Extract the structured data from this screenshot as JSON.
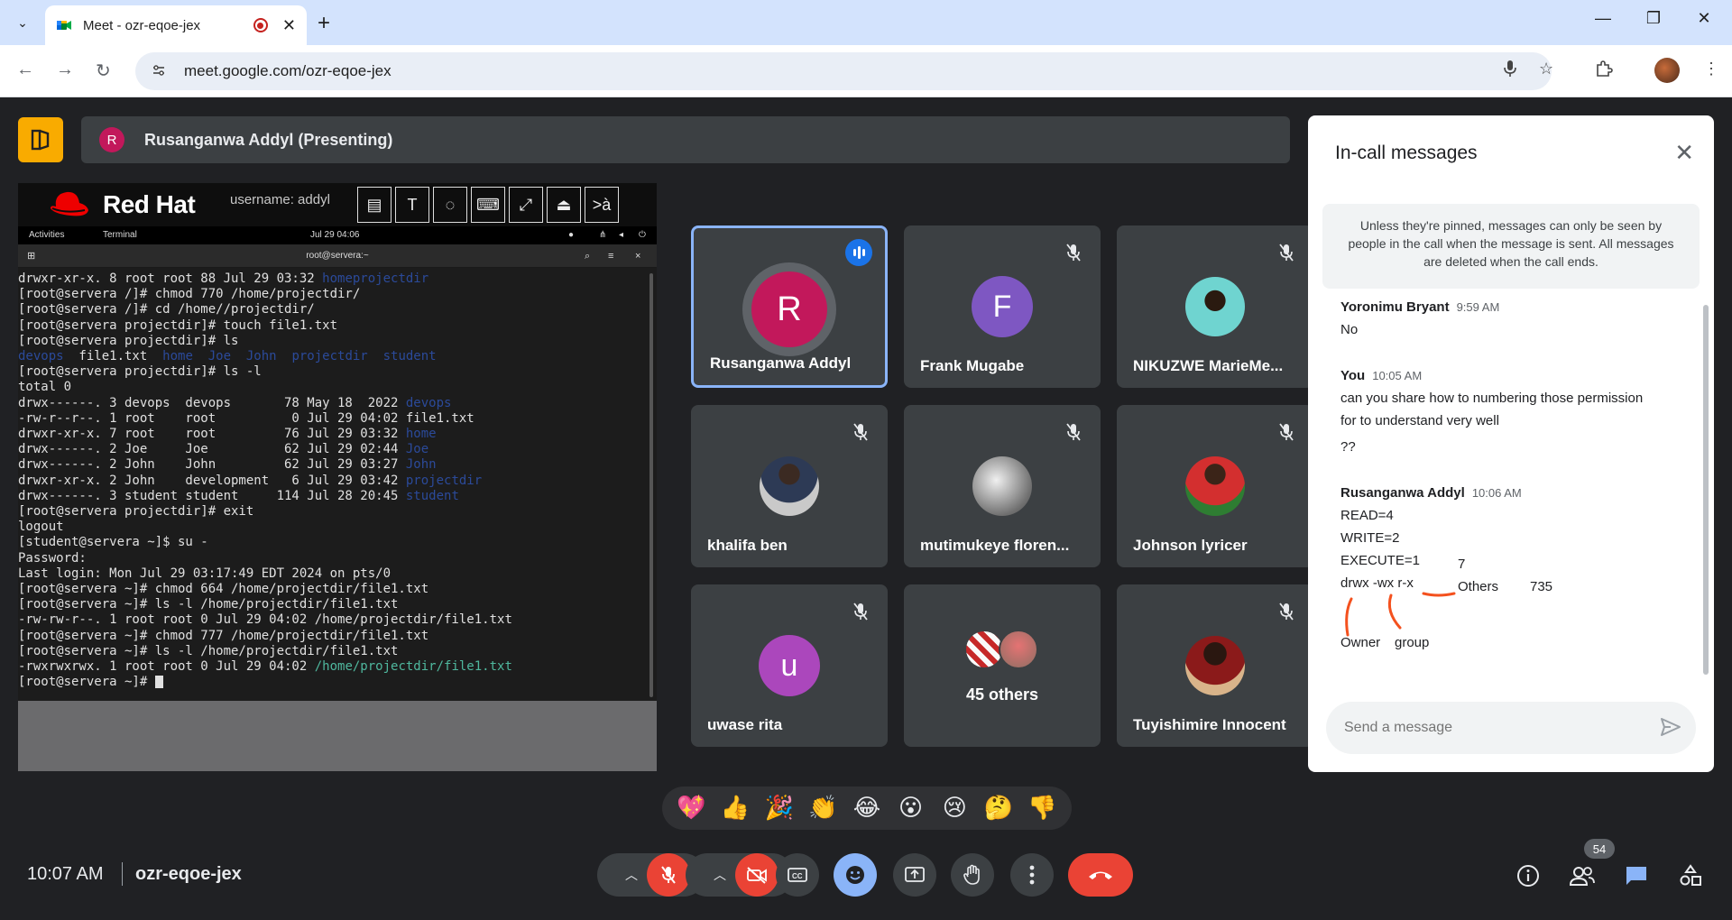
{
  "browser": {
    "tab_title": "Meet - ozr-eqoe-jex",
    "url": "meet.google.com/ozr-eqoe-jex"
  },
  "presenting": {
    "initial": "R",
    "label": "Rusanganwa Addyl (Presenting)"
  },
  "presentation": {
    "brand": "Red Hat",
    "username_label": "username: addyl",
    "tool_labels": [
      "T",
      ">à"
    ],
    "gnome": {
      "activities": "Activities",
      "terminal": "Terminal",
      "datetime": "Jul 29  04:06"
    },
    "terminal_title": "root@servera:~",
    "lines": [
      {
        "t": "drwxr-xr-x. 8 root root 88 Jul 29 03:32 ",
        "d": "homeprojectdir"
      },
      {
        "t": "[root@servera /]# chmod 770 /home/projectdir/",
        "d": ""
      },
      {
        "t": "[root@servera /]# cd /home//projectdir/",
        "d": ""
      },
      {
        "t": "[root@servera projectdir]# touch file1.txt",
        "d": ""
      },
      {
        "t": "[root@servera projectdir]# ls",
        "d": ""
      },
      {
        "t": "",
        "d": "devops",
        "t2": "  file1.txt  ",
        "d2": "home  Joe  John  projectdir  student"
      },
      {
        "t": "[root@servera projectdir]# ls -l",
        "d": ""
      },
      {
        "t": "total 0",
        "d": ""
      },
      {
        "t": "drwx------. 3 devops  devops       78 May 18  2022 ",
        "d": "devops"
      },
      {
        "t": "-rw-r--r--. 1 root    root          0 Jul 29 04:02 file1.txt",
        "d": ""
      },
      {
        "t": "drwxr-xr-x. 7 root    root         76 Jul 29 03:32 ",
        "d": "home"
      },
      {
        "t": "drwx------. 2 Joe     Joe          62 Jul 29 02:44 ",
        "d": "Joe"
      },
      {
        "t": "drwx------. 2 John    John         62 Jul 29 03:27 ",
        "d": "John"
      },
      {
        "t": "drwxr-xr-x. 2 John    development   6 Jul 29 03:42 ",
        "d": "projectdir"
      },
      {
        "t": "drwx------. 3 student student     114 Jul 28 20:45 ",
        "d": "student"
      },
      {
        "t": "[root@servera projectdir]# exit",
        "d": ""
      },
      {
        "t": "logout",
        "d": ""
      },
      {
        "t": "[student@servera ~]$ su -",
        "d": ""
      },
      {
        "t": "Password:",
        "d": ""
      },
      {
        "t": "Last login: Mon Jul 29 03:17:49 EDT 2024 on pts/0",
        "d": ""
      },
      {
        "t": "[root@servera ~]# chmod 664 /home/projectdir/file1.txt",
        "d": ""
      },
      {
        "t": "[root@servera ~]# ls -l /home/projectdir/file1.txt",
        "d": ""
      },
      {
        "t": "-rw-rw-r--. 1 root root 0 Jul 29 04:02 /home/projectdir/file1.txt",
        "d": ""
      },
      {
        "t": "[root@servera ~]# chmod 777 /home/projectdir/file1.txt",
        "d": ""
      },
      {
        "t": "[root@servera ~]# ls -l /home/projectdir/file1.txt",
        "d": ""
      },
      {
        "t": "-rwxrwxrwx. 1 root root 0 Jul 29 04:02 ",
        "g": "/home/projectdir/file1.txt"
      },
      {
        "t": "[root@servera ~]# ",
        "cursor": true
      }
    ]
  },
  "participants": [
    {
      "name": "Rusanganwa Addyl",
      "initial": "R",
      "color": "#c2185b",
      "speaking": true
    },
    {
      "name": "Frank Mugabe",
      "initial": "F",
      "color": "#7e57c2"
    },
    {
      "name": "NIKUZWE MarieMe...",
      "photo": "teal"
    },
    {
      "name": "khalifa ben",
      "photo": "dark"
    },
    {
      "name": "mutimukeye floren...",
      "photo": "gray"
    },
    {
      "name": "Johnson lyricer",
      "photo": "red"
    },
    {
      "name": "uwase rita",
      "initial": "u",
      "color": "#ab47bc"
    },
    {
      "name": "45 others",
      "others": true
    },
    {
      "name": "Tuyishimire Innocent",
      "photo": "darkred"
    }
  ],
  "messages_panel": {
    "title": "In-call messages",
    "notice": "Unless they're pinned, messages can only be seen by people in the call when the message is sent. All messages are deleted when the call ends.",
    "messages": [
      {
        "sender": "Yoronimu Bryant",
        "time": "9:59 AM",
        "lines": [
          "No"
        ]
      },
      {
        "sender": "You",
        "time": "10:05 AM",
        "lines": [
          "can you share how to numbering those permission",
          "for to understand very well",
          "??"
        ]
      },
      {
        "sender": "Rusanganwa Addyl",
        "time": "10:06 AM",
        "lines": [
          "READ=4",
          "WRITE=2",
          "EXECUTE=1",
          "drwx -wx r-x"
        ]
      }
    ],
    "annotation": {
      "seven": "7",
      "others": "Others",
      "num": "735",
      "owner": "Owner",
      "group": "group"
    },
    "input_placeholder": "Send a message"
  },
  "reactions": [
    "💖",
    "👍",
    "🎉",
    "👏",
    "😂",
    "😮",
    "😢",
    "🤔",
    "👎"
  ],
  "bottom": {
    "time": "10:07 AM",
    "meeting_code": "ozr-eqoe-jex",
    "people_count": "54"
  },
  "colors": {
    "end_call": "#ea4335",
    "accent": "#8ab4f8",
    "companion": "#f9ab00"
  }
}
